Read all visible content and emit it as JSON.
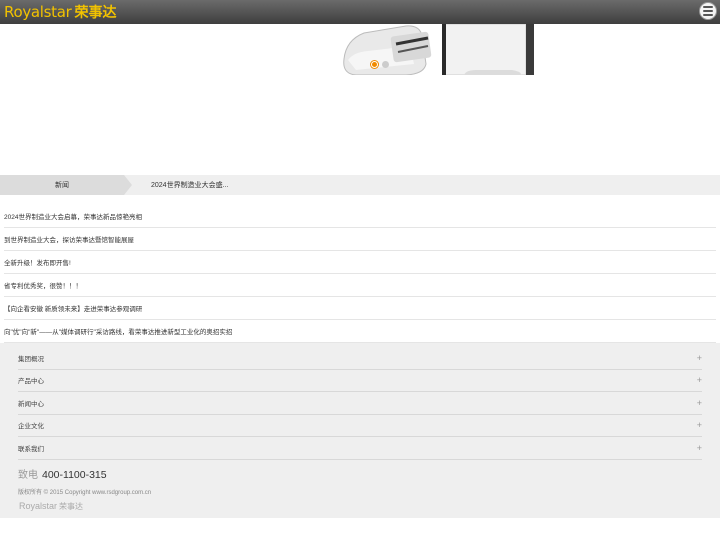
{
  "header": {
    "logo_en": "Royalstar",
    "logo_cn": "荣事达",
    "brand_color": "#f2c200",
    "menu_icon": "hamburger-menu-icon"
  },
  "banner": {
    "slide_count": 2,
    "active_slide": 1
  },
  "breadcrumb": {
    "section": "新闻",
    "current": "2024世界制造业大会盛..."
  },
  "news": [
    "2024世界制造业大会启幕，荣事达新品惊艳亮相",
    "到世界制造业大会，探访荣事达暨馆智能展屋",
    "全新升级！发布即开售!",
    "省专利优秀奖，很赞！！！",
    "【向企看安徽 新质领未来】走进荣事达参观调研",
    "向\"优\"向\"新\"——从\"媒体调研行\"采访路线，看荣事达推进新型工业化的奥招实招"
  ],
  "footer": {
    "nav": [
      "集团概况",
      "产品中心",
      "新闻中心",
      "企业文化",
      "联系我们"
    ],
    "expand_icon": "plus-icon",
    "phone_label": "致电",
    "phone_number": "400-1100-315",
    "copyright": "版权所有 © 2015 Copyright www.rsdgroup.com.cn",
    "logo_en": "Royalstar",
    "logo_cn": "荣事达"
  }
}
